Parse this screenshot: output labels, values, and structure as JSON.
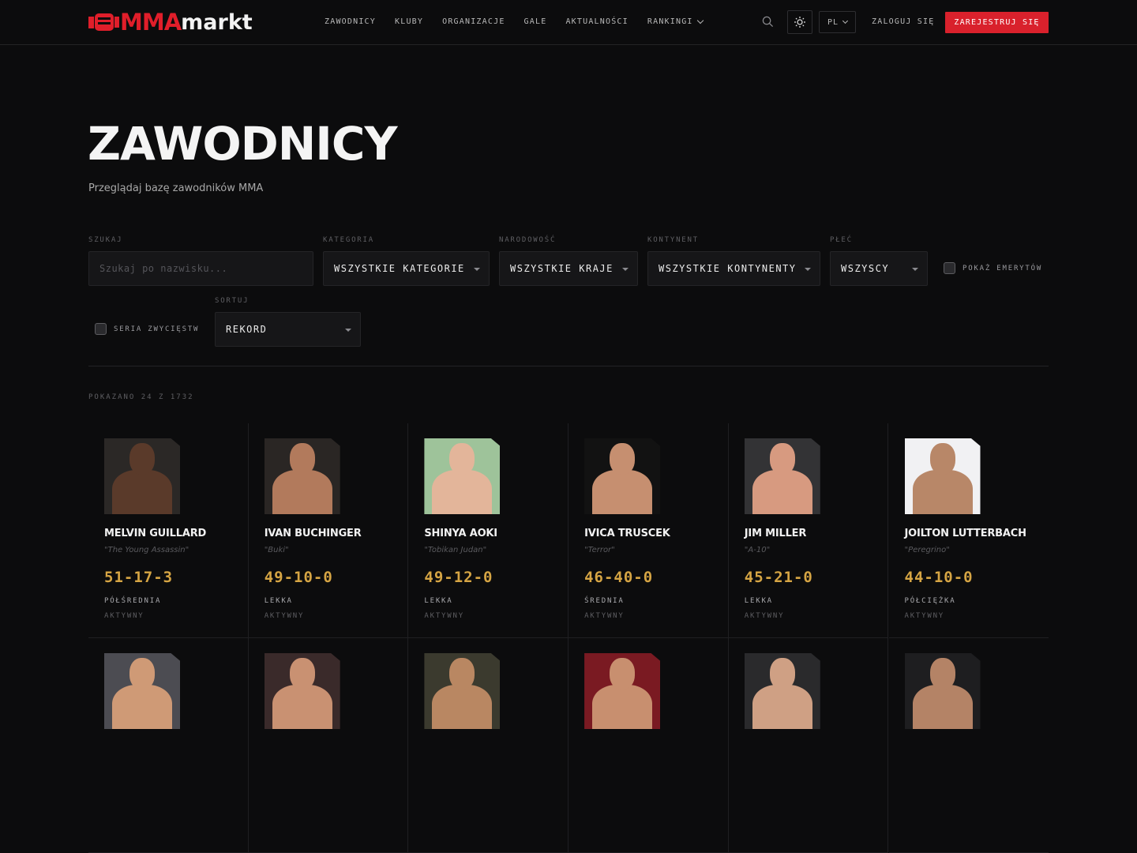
{
  "header": {
    "logo_primary": "MMA",
    "logo_secondary": "markt",
    "nav": [
      {
        "label": "ZAWODNICY"
      },
      {
        "label": "KLUBY"
      },
      {
        "label": "ORGANIZACJE"
      },
      {
        "label": "GALE"
      },
      {
        "label": "AKTUALNOŚCI"
      },
      {
        "label": "RANKINGI",
        "has_dropdown": true
      }
    ],
    "language": "PL",
    "login_label": "ZALOGUJ SIĘ",
    "register_label": "ZAREJESTRUJ SIĘ",
    "icons": [
      "search-icon",
      "sun-icon",
      "chevron-down-icon"
    ]
  },
  "page": {
    "title": "ZAWODNICY",
    "subtitle": "Przeglądaj bazę zawodników MMA"
  },
  "filters": {
    "search": {
      "label": "SZUKAJ",
      "placeholder": "Szukaj po nazwisku...",
      "value": ""
    },
    "category": {
      "label": "KATEGORIA",
      "value": "WSZYSTKIE KATEGORIE"
    },
    "nationality": {
      "label": "NARODOWOŚĆ",
      "value": "WSZYSTKIE KRAJE"
    },
    "continent": {
      "label": "KONTYNENT",
      "value": "WSZYSTKIE KONTYNENTY"
    },
    "gender": {
      "label": "PŁEĆ",
      "value": "WSZYSCY"
    },
    "retired": {
      "label": "POKAŻ EMERYTÓW",
      "checked": false
    },
    "streak": {
      "label": "SERIA ZWYCIĘSTW",
      "checked": false
    },
    "sort": {
      "label": "SORTUJ",
      "value": "REKORD"
    }
  },
  "results": {
    "count_text": "POKAZANO 24 Z 1732"
  },
  "fighters": [
    {
      "name": "MELVIN GUILLARD",
      "nickname": "\"The Young Assassin\"",
      "record": "51-17-3",
      "weight_class": "PÓŁŚREDNIA",
      "status": "AKTYWNY",
      "skin": "#5a3a2a",
      "bg": "#2b2826"
    },
    {
      "name": "IVAN BUCHINGER",
      "nickname": "\"Buki\"",
      "record": "49-10-0",
      "weight_class": "LEKKA",
      "status": "AKTYWNY",
      "skin": "#b27a5c",
      "bg": "#2a2624"
    },
    {
      "name": "SHINYA AOKI",
      "nickname": "\"Tobikan Judan\"",
      "record": "49-12-0",
      "weight_class": "LEKKA",
      "status": "AKTYWNY",
      "skin": "#e3b59a",
      "bg": "#9ec39a"
    },
    {
      "name": "IVICA TRUSCEK",
      "nickname": "\"Terror\"",
      "record": "46-40-0",
      "weight_class": "ŚREDNIA",
      "status": "AKTYWNY",
      "skin": "#c68f70",
      "bg": "#121212"
    },
    {
      "name": "JIM MILLER",
      "nickname": "\"A-10\"",
      "record": "45-21-0",
      "weight_class": "LEKKA",
      "status": "AKTYWNY",
      "skin": "#d79a80",
      "bg": "#333335"
    },
    {
      "name": "JOILTON LUTTERBACH",
      "nickname": "\"Peregrino\"",
      "record": "44-10-0",
      "weight_class": "PÓŁCIĘŻKA",
      "status": "AKTYWNY",
      "skin": "#b88768",
      "bg": "#f1f1f3"
    },
    {
      "name": "",
      "nickname": "",
      "record": "",
      "weight_class": "",
      "status": "",
      "skin": "#cf9a76",
      "bg": "#4c4c52"
    },
    {
      "name": "",
      "nickname": "",
      "record": "",
      "weight_class": "",
      "status": "",
      "skin": "#c99172",
      "bg": "#3a2a2a"
    },
    {
      "name": "",
      "nickname": "",
      "record": "",
      "weight_class": "",
      "status": "",
      "skin": "#b98762",
      "bg": "#3b3a2e"
    },
    {
      "name": "",
      "nickname": "",
      "record": "",
      "weight_class": "",
      "status": "",
      "skin": "#c88f6f",
      "bg": "#7a1a22"
    },
    {
      "name": "",
      "nickname": "",
      "record": "",
      "weight_class": "",
      "status": "",
      "skin": "#cfa084",
      "bg": "#2a2a2c"
    },
    {
      "name": "",
      "nickname": "",
      "record": "",
      "weight_class": "",
      "status": "",
      "skin": "#b48366",
      "bg": "#1e1e20"
    }
  ],
  "colors": {
    "accent": "#d9212c",
    "record": "#d6a544",
    "background": "#0c0c0d"
  }
}
